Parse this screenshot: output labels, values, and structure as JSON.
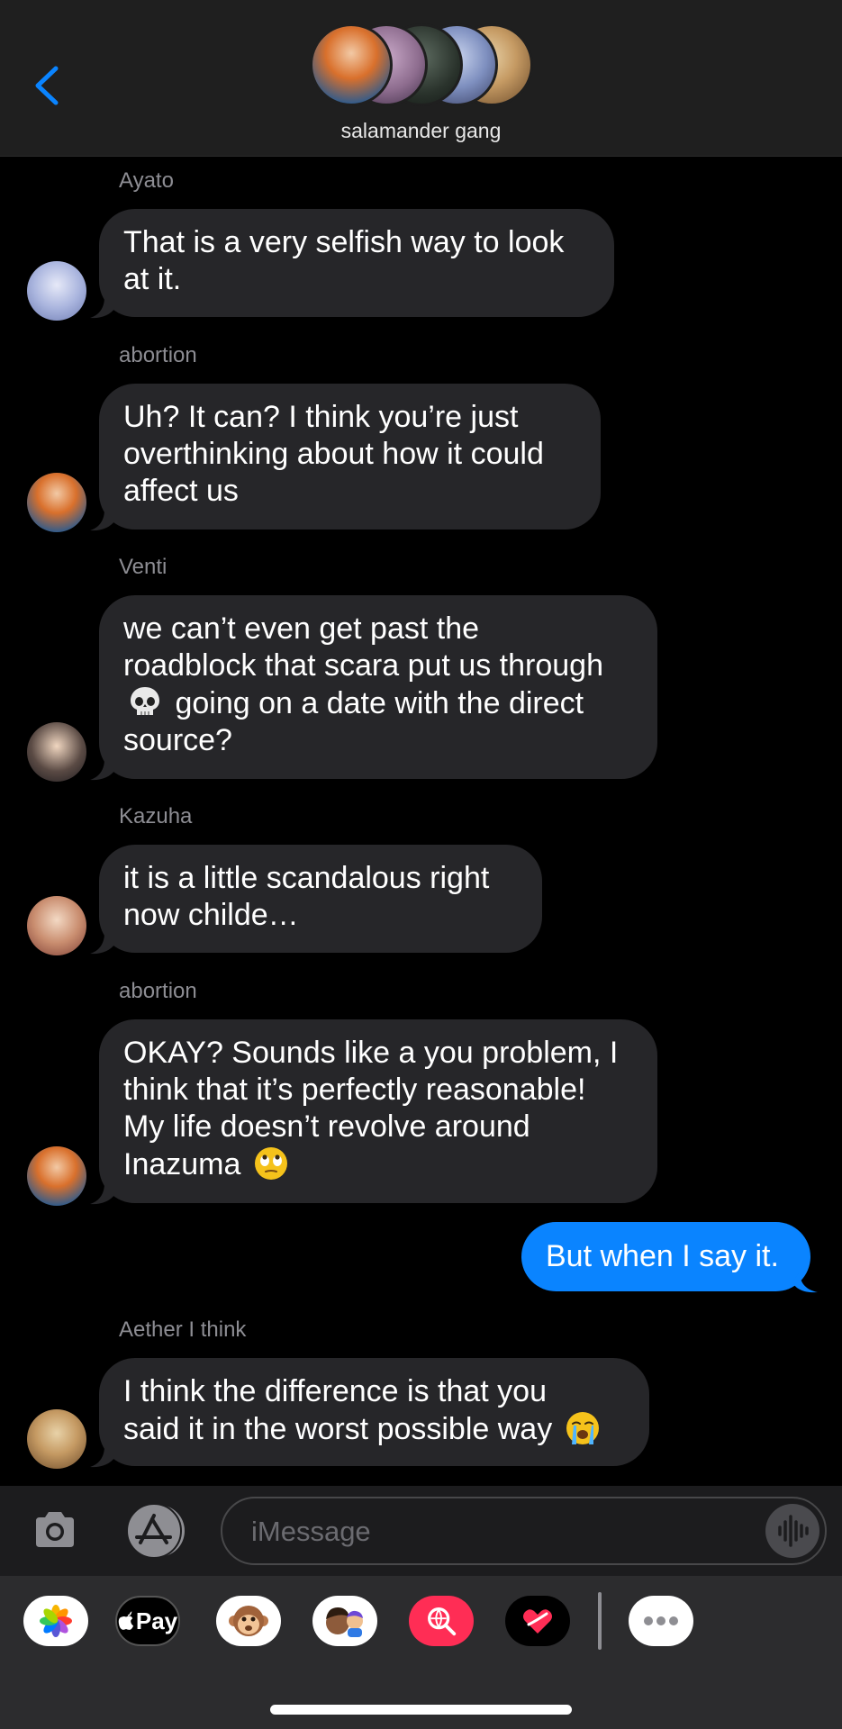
{
  "header": {
    "back_icon": "chevron-left-icon",
    "group_name": "salamander gang",
    "accent": "#0a84ff"
  },
  "messages": [
    {
      "sender": "Ayato",
      "text": "That is a very selfish way to look at it.",
      "lines": [
        "That is a very selfish way to look",
        "at it."
      ],
      "from_me": false
    },
    {
      "sender": "abortion",
      "text": "Uh? It can? I think you’re just overthinking about how it could affect us",
      "lines": [
        "Uh? It can? I think you’re just",
        "overthinking about how it could",
        "affect us"
      ],
      "from_me": false
    },
    {
      "sender": "Venti",
      "text": "we can’t even get past the roadblock that scara put us through 💀 going on a date with the direct source?",
      "lines": [
        "we can’t even get past the",
        "roadblock that scara put us through",
        "going on a date with the direct",
        "source?"
      ],
      "emoji": "skull-emoji",
      "from_me": false
    },
    {
      "sender": "Kazuha",
      "text": "it is a little scandalous right now childe…",
      "lines": [
        "it is a little scandalous right",
        "now childe…"
      ],
      "from_me": false
    },
    {
      "sender": "abortion",
      "text": "OKAY? Sounds like a you problem, I think that it’s perfectly reasonable! My life doesn’t revolve around Inazuma 🙄",
      "lines": [
        "OKAY? Sounds like a you problem, I",
        "think that it’s perfectly reasonable!",
        "My life doesn’t revolve around",
        "Inazuma"
      ],
      "emoji": "eye-roll-emoji",
      "from_me": false
    },
    {
      "sender": "",
      "text": "But when I say it.",
      "lines": [
        "But when I say it."
      ],
      "from_me": true
    },
    {
      "sender": "Aether I think",
      "text": "I think the difference is that you said it in the worst possible way 😭",
      "lines": [
        "I think the difference is that you",
        "said it in the worst possible way"
      ],
      "emoji": "crying-emoji",
      "from_me": false
    }
  ],
  "input": {
    "camera_icon": "camera-icon",
    "apps_icon": "app-store-icon",
    "placeholder": "iMessage",
    "audio_icon": "waveform-icon"
  },
  "drawer": {
    "apps": [
      "photos-icon",
      "apple-pay-icon",
      "animoji-icon",
      "memoji-icon",
      "web-search-icon",
      "digital-touch-icon",
      "more-icon"
    ],
    "apple_pay_label": "Pay"
  }
}
